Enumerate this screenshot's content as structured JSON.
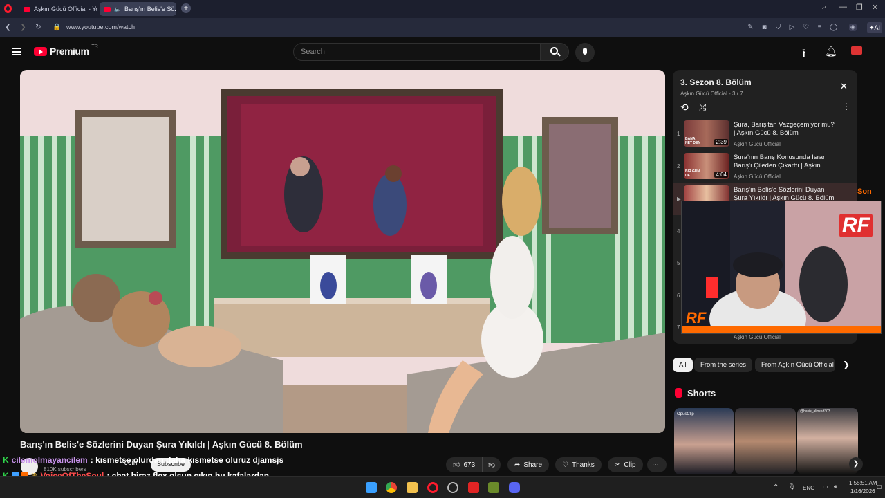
{
  "browser": {
    "tabs": [
      {
        "label": "Aşkın Gücü Official - YouTu"
      },
      {
        "label": "Barış'ın Belis'e Sözlerini"
      }
    ],
    "url": "www.youtube.com/watch",
    "ai_label": "AI"
  },
  "yt_header": {
    "logo_text": "Premium",
    "logo_region": "TR",
    "search_placeholder": "Search"
  },
  "player": {
    "tv_chips": [
      "Son"
    ]
  },
  "playlist": {
    "title": "3. Sezon 8. Bölüm",
    "subtitle": "Aşkın Gücü Official - 3 / 7",
    "items": [
      {
        "num": "1",
        "title": "Şura, Barış'tan Vazgeçemiyor mu? | Aşkın Gücü 8. Bölüm",
        "channel": "Aşkın Gücü Official",
        "duration": "2:39",
        "thumb_text": "BANA NET DEN"
      },
      {
        "num": "2",
        "title": "Şura'nın Barış Konusunda Israrı Barış'ı Çileden Çıkarttı | Aşkın...",
        "channel": "Aşkın Gücü Official",
        "duration": "4:04",
        "thumb_text": "BİR GÜN DE"
      },
      {
        "num": "▶",
        "title": "Barış'ın Belis'e Sözlerini Duyan Şura Yıkıldı | Aşkın Gücü 8. Bölüm",
        "channel": "",
        "duration": "",
        "thumb_text": ""
      }
    ],
    "hidden_nums": [
      "4",
      "5",
      "6",
      "7"
    ],
    "last_channel": "Aşkın Gücü Official"
  },
  "webcam": {
    "brand_text": "RF"
  },
  "chips": [
    {
      "label": "All"
    },
    {
      "label": "From the series"
    },
    {
      "label": "From Aşkın Gücü Official"
    }
  ],
  "shorts": {
    "heading": "Shorts",
    "labels": [
      "OpusClip",
      "@basis_aliosed303"
    ]
  },
  "video": {
    "title": "Barış'ın Belis'e Sözlerini Duyan Şura Yıkıldı | Aşkın Gücü 8. Bölüm",
    "subscribers": "810K subscribers",
    "join_label": "Join",
    "subscribe_label": "Subscribe",
    "likes": "673",
    "share_label": "Share",
    "thanks_label": "Thanks",
    "clip_label": "Clip"
  },
  "chat": [
    {
      "user": "cilemolmayancilem",
      "message": ": kısmetse olurdan daha kısmetse oluruz djamsjs",
      "user_color": "#c792ea"
    },
    {
      "user": "VoiceOfTheSoul",
      "message": ": chat biraz flex olsun çıkın bu kafalardan",
      "user_color": "#ff4d4d"
    }
  ],
  "taskbar": {
    "lang": "ENG",
    "time": "1:55:51 AM",
    "date": "1/16/2026"
  },
  "colors": {
    "yt_red": "#ff0033",
    "accent_orange": "#ff6a00",
    "chat_green": "#2fd34a"
  }
}
